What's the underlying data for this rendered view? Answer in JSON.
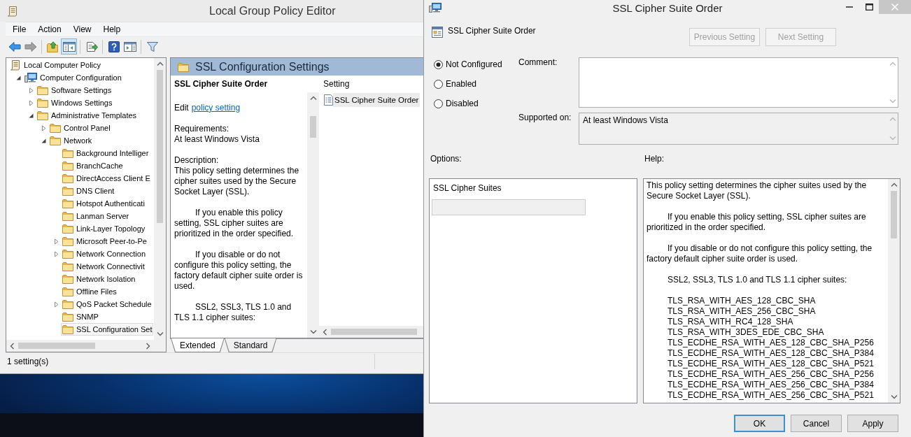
{
  "editor": {
    "title": "Local Group Policy Editor",
    "menu": [
      "File",
      "Action",
      "View",
      "Help"
    ],
    "toolbar": [
      [
        {
          "kind": "back",
          "disabled": false,
          "pressed": false
        },
        {
          "kind": "forward",
          "disabled": true,
          "pressed": false
        }
      ],
      [
        {
          "kind": "up",
          "disabled": false,
          "pressed": false
        },
        {
          "kind": "tree",
          "disabled": false,
          "pressed": true
        }
      ],
      [
        {
          "kind": "export",
          "disabled": false,
          "pressed": false
        }
      ],
      [
        {
          "kind": "help",
          "disabled": false,
          "pressed": false
        },
        {
          "kind": "pane",
          "disabled": false,
          "pressed": false
        }
      ],
      [
        {
          "kind": "filter",
          "disabled": false,
          "pressed": false
        }
      ]
    ],
    "tree": [
      {
        "label": "Local Computer Policy",
        "kind": "policy",
        "selected": false,
        "children": [
          {
            "label": "Computer Configuration",
            "kind": "computer",
            "expanded": true,
            "selected": false,
            "children": [
              {
                "label": "Software Settings",
                "kind": "folder",
                "expanded": false,
                "selected": false
              },
              {
                "label": "Windows Settings",
                "kind": "folder",
                "expanded": false,
                "selected": false
              },
              {
                "label": "Administrative Templates",
                "kind": "folder",
                "expanded": true,
                "selected": false,
                "children": [
                  {
                    "label": "Control Panel",
                    "kind": "folder",
                    "expanded": false,
                    "selected": false
                  },
                  {
                    "label": "Network",
                    "kind": "folder",
                    "expanded": true,
                    "selected": false,
                    "children": [
                      {
                        "label": "Background Intelliger",
                        "kind": "folder",
                        "selected": false
                      },
                      {
                        "label": "BranchCache",
                        "kind": "folder",
                        "selected": false
                      },
                      {
                        "label": "DirectAccess Client E",
                        "kind": "folder",
                        "selected": false
                      },
                      {
                        "label": "DNS Client",
                        "kind": "folder",
                        "selected": false
                      },
                      {
                        "label": "Hotspot Authenticati",
                        "kind": "folder",
                        "selected": false
                      },
                      {
                        "label": "Lanman Server",
                        "kind": "folder",
                        "selected": false
                      },
                      {
                        "label": "Link-Layer Topology",
                        "kind": "folder",
                        "selected": false
                      },
                      {
                        "label": "Microsoft Peer-to-Pe",
                        "kind": "folder",
                        "expanded": false,
                        "selected": false
                      },
                      {
                        "label": "Network Connection",
                        "kind": "folder",
                        "expanded": false,
                        "selected": false
                      },
                      {
                        "label": "Network Connectivit",
                        "kind": "folder",
                        "selected": false
                      },
                      {
                        "label": "Network Isolation",
                        "kind": "folder",
                        "selected": false
                      },
                      {
                        "label": "Offline Files",
                        "kind": "folder",
                        "selected": false
                      },
                      {
                        "label": "QoS Packet Schedule",
                        "kind": "folder",
                        "expanded": false,
                        "selected": false
                      },
                      {
                        "label": "SNMP",
                        "kind": "folder",
                        "selected": false
                      },
                      {
                        "label": "SSL Configuration Set",
                        "kind": "folder",
                        "selected": true
                      }
                    ]
                  }
                ]
              }
            ]
          }
        ]
      }
    ],
    "details": {
      "header": "SSL Configuration Settings",
      "description": {
        "title": "SSL Cipher Suite Order",
        "edit_label": "Edit",
        "edit_link": "policy setting",
        "requirements_label": "Requirements:",
        "requirements": "At least Windows Vista",
        "description_label": "Description:",
        "paragraphs": [
          {
            "indented": false,
            "text": "This policy setting determines the cipher suites used by the Secure Socket Layer (SSL)."
          },
          {
            "indented": true,
            "text": "If you enable this policy setting, SSL cipher suites are prioritized in the order specified."
          },
          {
            "indented": true,
            "text": "If you disable or do not configure this policy setting, the factory default cipher suite order is used."
          },
          {
            "indented": true,
            "text": "SSL2, SSL3, TLS 1.0 and TLS 1.1 cipher suites:"
          }
        ]
      },
      "list": {
        "column": "Setting",
        "rows": [
          {
            "label": "SSL Cipher Suite Order",
            "selected": true
          }
        ]
      },
      "tabs": [
        {
          "label": "Extended",
          "selected": true
        },
        {
          "label": "Standard",
          "selected": false
        }
      ]
    },
    "status_bar": {
      "text": "1 setting(s)"
    }
  },
  "dialog": {
    "title": "SSL Cipher Suite Order",
    "setting": "SSL Cipher Suite Order",
    "nav_buttons": [
      {
        "label": "Previous Setting",
        "disabled": true
      },
      {
        "label": "Next Setting",
        "disabled": true
      }
    ],
    "states": [
      {
        "label": "Not Configured",
        "selected": true
      },
      {
        "label": "Enabled",
        "selected": false
      },
      {
        "label": "Disabled",
        "selected": false
      }
    ],
    "comment": {
      "label": "Comment:"
    },
    "supported_on": {
      "label": "Supported on:",
      "value": "At least Windows Vista"
    },
    "options": {
      "label": "Options:",
      "fields": [
        {
          "label": "SSL Cipher Suites",
          "disabled": true
        }
      ]
    },
    "help": {
      "label": "Help:",
      "blocks": [
        {
          "kind": "text",
          "indented": false,
          "text": "This policy setting determines the cipher suites used by the Secure Socket Layer (SSL)."
        },
        {
          "kind": "text",
          "indented": true,
          "text": "If you enable this policy setting, SSL cipher suites are prioritized in the order specified."
        },
        {
          "kind": "text",
          "indented": true,
          "text": "If you disable or do not configure this policy setting, the factory default cipher suite order is used."
        },
        {
          "kind": "text",
          "indented": true,
          "text": "SSL2, SSL3, TLS 1.0 and TLS 1.1 cipher suites:"
        },
        {
          "kind": "list",
          "items": [
            "TLS_RSA_WITH_AES_128_CBC_SHA",
            "TLS_RSA_WITH_AES_256_CBC_SHA",
            "TLS_RSA_WITH_RC4_128_SHA",
            "TLS_RSA_WITH_3DES_EDE_CBC_SHA",
            "TLS_ECDHE_RSA_WITH_AES_128_CBC_SHA_P256",
            "TLS_ECDHE_RSA_WITH_AES_128_CBC_SHA_P384",
            "TLS_ECDHE_RSA_WITH_AES_128_CBC_SHA_P521",
            "TLS_ECDHE_RSA_WITH_AES_256_CBC_SHA_P256",
            "TLS_ECDHE_RSA_WITH_AES_256_CBC_SHA_P384",
            "TLS_ECDHE_RSA_WITH_AES_256_CBC_SHA_P521"
          ]
        }
      ]
    },
    "buttons": [
      {
        "label": "OK",
        "default": true
      },
      {
        "label": "Cancel",
        "default": false
      },
      {
        "label": "Apply",
        "default": false
      }
    ]
  }
}
